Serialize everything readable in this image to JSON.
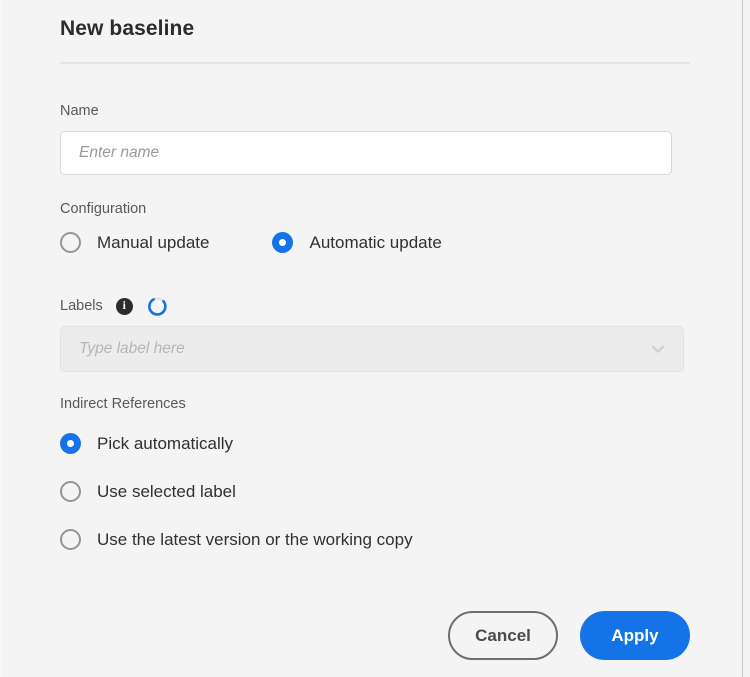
{
  "dialog": {
    "title": "New baseline"
  },
  "name_field": {
    "label": "Name",
    "placeholder": "Enter name",
    "value": ""
  },
  "configuration": {
    "label": "Configuration",
    "options": [
      {
        "label": "Manual update",
        "selected": false
      },
      {
        "label": "Automatic update",
        "selected": true
      }
    ]
  },
  "labels": {
    "label": "Labels",
    "info_icon": "info-icon",
    "loading_icon": "loading-spinner-icon",
    "loading": true,
    "select": {
      "placeholder": "Type label here",
      "value": "",
      "disabled": true,
      "chevron_icon": "chevron-down-icon"
    }
  },
  "indirect_references": {
    "label": "Indirect References",
    "options": [
      {
        "label": "Pick automatically",
        "selected": true
      },
      {
        "label": "Use selected label",
        "selected": false
      },
      {
        "label": "Use the latest version or the working copy",
        "selected": false
      }
    ]
  },
  "footer": {
    "cancel_label": "Cancel",
    "apply_label": "Apply"
  },
  "colors": {
    "accent_blue": "#1473e6",
    "background": "#f4f4f4",
    "text_primary": "#2c2c2c",
    "text_label": "#585858",
    "border_gray": "#d8d8d8",
    "disabled_field": "#ececec"
  }
}
